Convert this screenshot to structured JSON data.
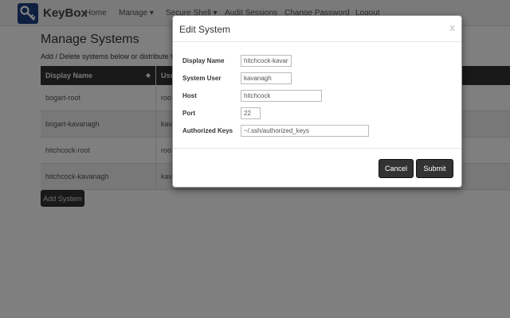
{
  "navbar": {
    "brand": "KeyBox",
    "items": [
      {
        "label": "Home"
      },
      {
        "label": "Manage ▾"
      },
      {
        "label": "Secure Shell ▾"
      },
      {
        "label": "Audit Sessions"
      },
      {
        "label": "Change Password"
      },
      {
        "label": "Logout"
      }
    ]
  },
  "page": {
    "title": "Manage Systems",
    "description": "Add / Delete systems below or distribute t"
  },
  "table": {
    "headers": [
      "Display Name",
      "Use"
    ],
    "rows": [
      [
        "bogart-root",
        "roo"
      ],
      [
        "bogart-kavanagh",
        "kav"
      ],
      [
        "hitchcock-root",
        "roo"
      ],
      [
        "hitchcock-kavanagh",
        "kav"
      ]
    ]
  },
  "add_button_label": "Add System",
  "modal": {
    "title": "Edit System",
    "close_label": "x",
    "fields": [
      {
        "label": "Display Name",
        "value": "hitchcock-kavanagh"
      },
      {
        "label": "System User",
        "value": "kavanagh"
      },
      {
        "label": "Host",
        "value": "hitchcock"
      },
      {
        "label": "Port",
        "value": "22"
      },
      {
        "label": "Authorized Keys",
        "value": "~/.ssh/authorized_keys"
      }
    ],
    "cancel_label": "Cancel",
    "submit_label": "Submit"
  }
}
